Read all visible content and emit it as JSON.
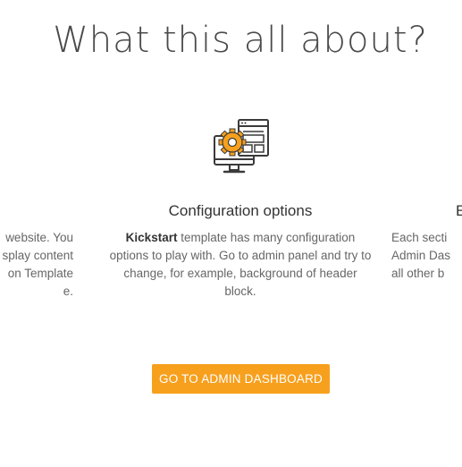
{
  "section_title": "What this all about?",
  "left_feature": {
    "lines": [
      "website. You",
      "splay content",
      "on Template",
      "e."
    ]
  },
  "center_feature": {
    "icon": "config-monitor-gear-icon",
    "title": "Configuration options",
    "text_bold": "Kickstart",
    "text_rest": " template has many configuration options to play with. Go to admin panel and try to change, for example, background of header block."
  },
  "right_feature": {
    "title_fragment": "E",
    "lines": [
      "Each secti",
      "Admin Das",
      "all other b"
    ]
  },
  "cta_button": "GO TO ADMIN DASHBOARD",
  "colors": {
    "accent": "#f7a01e",
    "icon_dark": "#3a3a3a"
  }
}
